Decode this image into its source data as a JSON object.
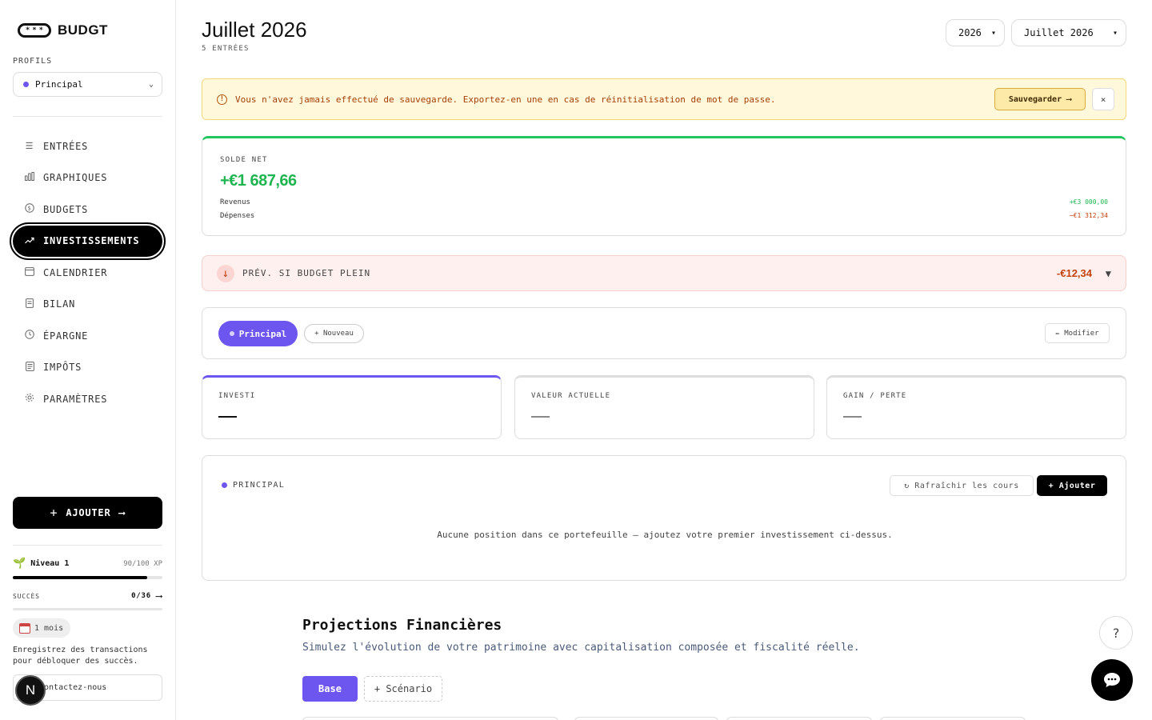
{
  "app": {
    "name": "BUDGT"
  },
  "sidebar": {
    "profiles_label": "PROFILS",
    "profile_selected": "Principal",
    "nav": [
      {
        "label": "ENTRÉES",
        "icon": "list-icon"
      },
      {
        "label": "GRAPHIQUES",
        "icon": "bar-chart-icon"
      },
      {
        "label": "BUDGETS",
        "icon": "coin-icon"
      },
      {
        "label": "INVESTISSEMENTS",
        "icon": "trending-up-icon"
      },
      {
        "label": "CALENDRIER",
        "icon": "calendar-icon"
      },
      {
        "label": "BILAN",
        "icon": "document-icon"
      },
      {
        "label": "ÉPARGNE",
        "icon": "clock-icon"
      },
      {
        "label": "IMPÔTS",
        "icon": "receipt-icon"
      },
      {
        "label": "PARAMÈTRES",
        "icon": "gear-icon"
      }
    ],
    "active_nav": "INVESTISSEMENTS",
    "add_label": "AJOUTER",
    "level_label": "Niveau 1",
    "xp_text": "90/100 XP",
    "xp_fraction": 0.9,
    "succes_label": "SUCCÈS",
    "succes_count": "0/36",
    "streak_badge": "1 mois",
    "hint": "Enregistrez des transactions pour débloquer des succès.",
    "contact_label": "Contactez-nous",
    "n_badge": "N"
  },
  "header": {
    "title": "Juillet 2026",
    "subtitle": "5 ENTRÉES",
    "year_select": "2026",
    "month_select": "Juillet 2026"
  },
  "warning": {
    "text": "Vous n'avez jamais effectué de sauvegarde. Exportez-en une en cas de réinitialisation de mot de passe.",
    "save_label": "Sauvegarder",
    "close_label": "×"
  },
  "balance": {
    "label": "SOLDE NET",
    "value": "+€1 687,66",
    "revenue_label": "Revenus",
    "revenue_value": "+€3 000,00",
    "expense_label": "Dépenses",
    "expense_value": "−€1 312,34",
    "accent": "#22c55e"
  },
  "forecast": {
    "label": "PRÉV. SI BUDGET PLEIN",
    "value": "-€12,34",
    "toggle": "▼"
  },
  "portfolios": {
    "active": "Principal",
    "new_label": "+ Nouveau",
    "modify_label": "✏ Modifier",
    "accent": "#6d55f0"
  },
  "stats": [
    {
      "label": "INVESTI",
      "value": "—"
    },
    {
      "label": "VALEUR ACTUELLE",
      "value": "—"
    },
    {
      "label": "GAIN / PERTE",
      "value": "—"
    }
  ],
  "positions": {
    "portfolio_name": "PRINCIPAL",
    "refresh_label": "↻ Rafraîchir les cours",
    "add_label": "+ Ajouter",
    "empty_text": "Aucune position dans ce portefeuille — ajoutez votre premier investissement ci-dessus."
  },
  "projections": {
    "title": "Projections Financières",
    "subtitle": "Simulez l'évolution de votre patrimoine avec capitalisation composée et fiscalité réelle.",
    "tabs": [
      "Base",
      "+ Scénario"
    ]
  },
  "floating": {
    "help": "?"
  }
}
